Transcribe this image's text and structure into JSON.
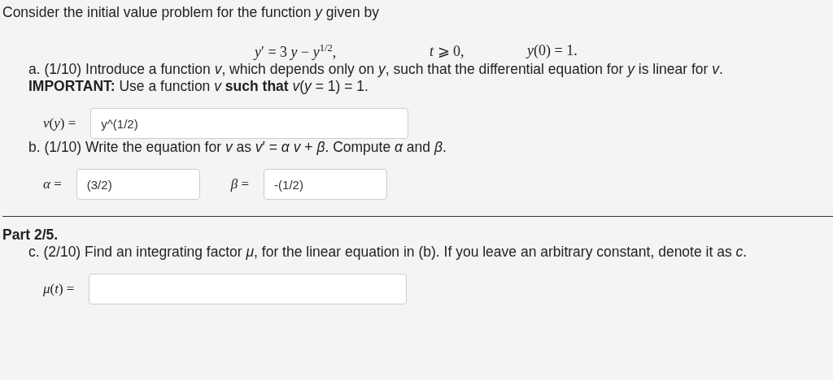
{
  "intro": "Consider the initial value problem for the function *y* given by",
  "equation": [
    "*y*′ = 3 *y* − *y*$^{1/2}$,",
    "*t* ⩾ 0,",
    "*y*(0) = 1."
  ],
  "parts": [
    {
      "kind": "question",
      "text": "a. (1/10) Introduce a function *v*, which depends only on *y*, such that the differential equation for *y* is linear for *v*.",
      "note": "**IMPORTANT:** Use a function *v* **such that** *v*(*y* = 1) = 1.",
      "fields": [
        {
          "label": "*v*(*y*) =",
          "value": "y^(1/2)",
          "kind": "wide"
        }
      ]
    },
    {
      "kind": "question",
      "text": "b. (1/10) Write the equation for *v* as *v*′ = *α* *v* + *β*. Compute *α* and *β*.",
      "fields": [
        {
          "label": "*α* =",
          "value": "(3/2)",
          "kind": "short"
        },
        {
          "label": "*β* =",
          "value": "-(1/2)",
          "kind": "short"
        }
      ]
    },
    {
      "kind": "heading",
      "text": "Part 2/5."
    },
    {
      "kind": "question",
      "text": "c. (2/10) Find an integrating factor *μ*, for the linear equation in (b). If you leave an arbitrary constant, denote it as *c*.",
      "fields": [
        {
          "label": "*μ*(*t*) =",
          "kind": "wide"
        }
      ]
    }
  ]
}
